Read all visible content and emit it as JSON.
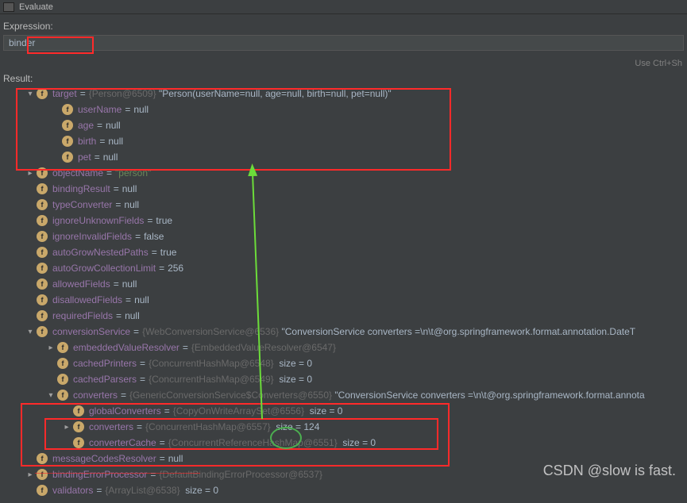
{
  "window": {
    "title": "Evaluate"
  },
  "expression": {
    "label": "Expression:",
    "value": "binder"
  },
  "hint_text": "Use Ctrl+Sh",
  "result_label": "Result:",
  "tree": {
    "target": {
      "name": "target",
      "ref": "{Person@6509}",
      "repr": "\"Person(userName=null, age=null, birth=null, pet=null)\"",
      "fields": {
        "userName": {
          "name": "userName",
          "value": "null"
        },
        "age": {
          "name": "age",
          "value": "null"
        },
        "birth": {
          "name": "birth",
          "value": "null"
        },
        "pet": {
          "name": "pet",
          "value": "null"
        }
      }
    },
    "objectName": {
      "name": "objectName",
      "value": "\"person\""
    },
    "bindingResult": {
      "name": "bindingResult",
      "value": "null"
    },
    "typeConverter": {
      "name": "typeConverter",
      "value": "null"
    },
    "ignoreUnknownFields": {
      "name": "ignoreUnknownFields",
      "value": "true"
    },
    "ignoreInvalidFields": {
      "name": "ignoreInvalidFields",
      "value": "false"
    },
    "autoGrowNestedPaths": {
      "name": "autoGrowNestedPaths",
      "value": "true"
    },
    "autoGrowCollectionLimit": {
      "name": "autoGrowCollectionLimit",
      "value": "256"
    },
    "allowedFields": {
      "name": "allowedFields",
      "value": "null"
    },
    "disallowedFields": {
      "name": "disallowedFields",
      "value": "null"
    },
    "requiredFields": {
      "name": "requiredFields",
      "value": "null"
    },
    "conversionService": {
      "name": "conversionService",
      "ref": "{WebConversionService@6536}",
      "repr": "\"ConversionService converters =\\n\\t@org.springframework.format.annotation.DateT",
      "embeddedValueResolver": {
        "name": "embeddedValueResolver",
        "ref": "{EmbeddedValueResolver@6547}"
      },
      "cachedPrinters": {
        "name": "cachedPrinters",
        "ref": "{ConcurrentHashMap@6548}",
        "size_label": "size = 0"
      },
      "cachedParsers": {
        "name": "cachedParsers",
        "ref": "{ConcurrentHashMap@6549}",
        "size_label": "size = 0"
      },
      "converters": {
        "name": "converters",
        "ref": "{GenericConversionService$Converters@6550}",
        "repr": "\"ConversionService converters =\\n\\t@org.springframework.format.annota",
        "globalConverters": {
          "name": "globalConverters",
          "ref": "{CopyOnWriteArraySet@6556}",
          "size_label": "size = 0"
        },
        "converters_inner": {
          "name": "converters",
          "ref": "{ConcurrentHashMap@6557}",
          "size_label": "size = 124"
        },
        "converterCache": {
          "name": "converterCache",
          "ref": "{ConcurrentReferenceHashMap@6551}",
          "size_label": "size = 0"
        }
      }
    },
    "messageCodesResolver": {
      "name": "messageCodesResolver",
      "value": "null"
    },
    "bindingErrorProcessor": {
      "name": "bindingErrorProcessor",
      "ref": "{DefaultBindingErrorProcessor@6537}"
    },
    "validators": {
      "name": "validators",
      "ref": "{ArrayList@6538}",
      "size_label": "size = 0"
    }
  },
  "watermark": "CSDN @slow is fast."
}
